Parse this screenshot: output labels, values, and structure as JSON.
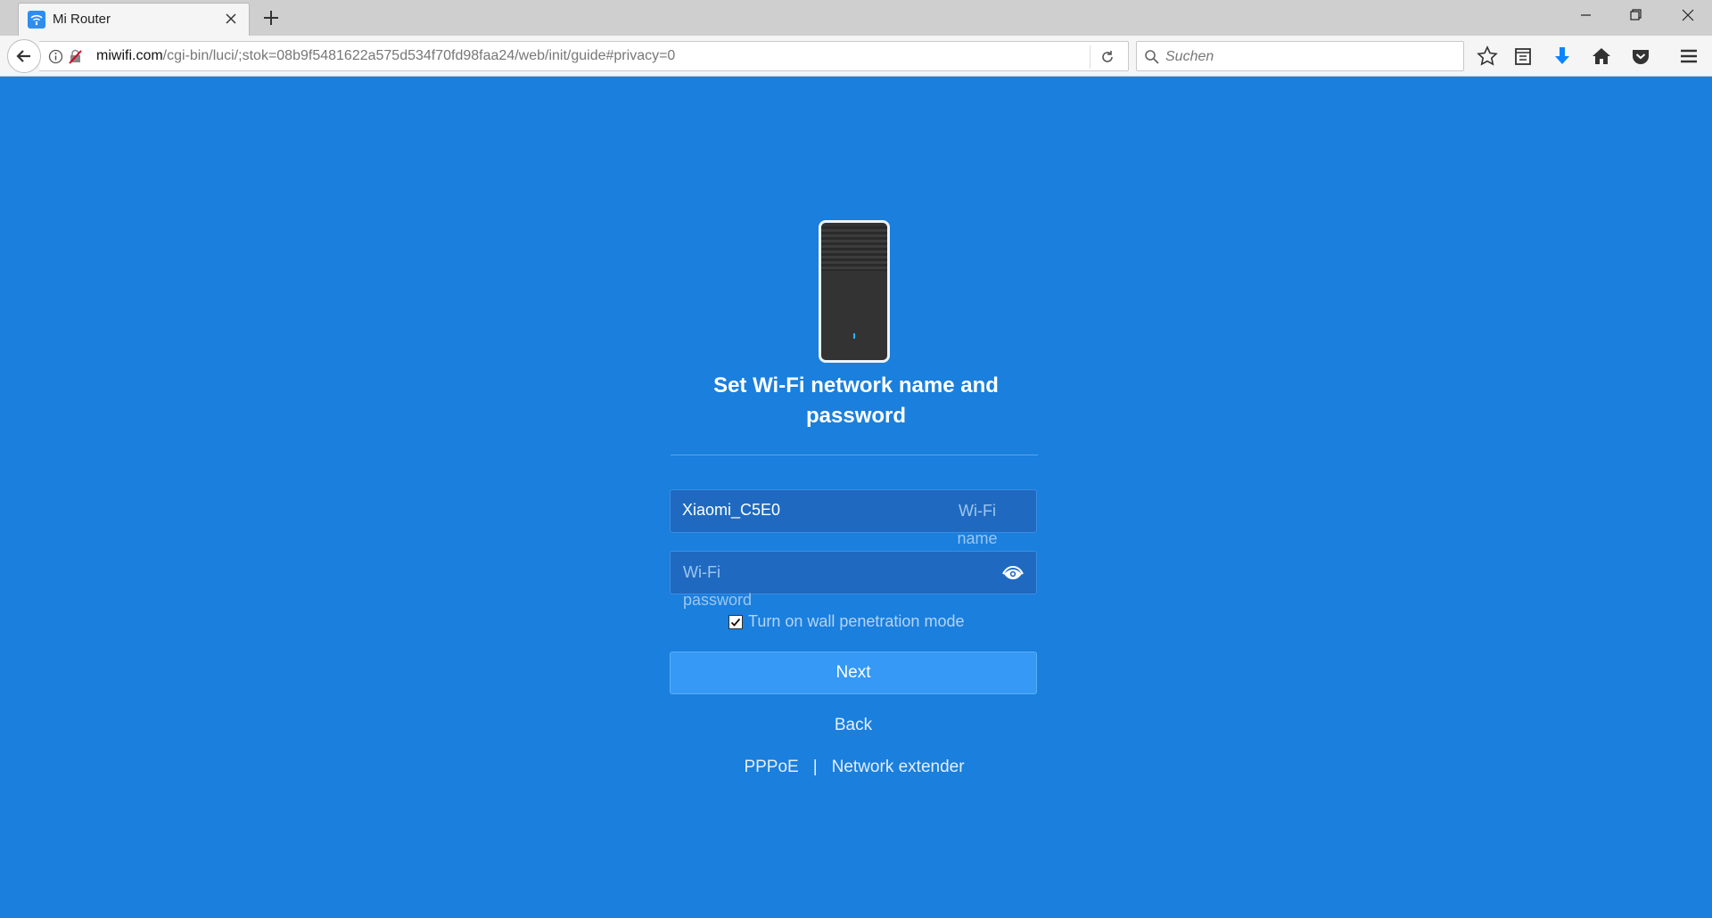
{
  "browser": {
    "tab_title": "Mi Router",
    "url_host": "miwifi.com",
    "url_path": "/cgi-bin/luci/;stok=08b9f5481622a575d534f70fd98faa24/web/init/guide#privacy=0",
    "search_placeholder": "Suchen",
    "toolbar_icons": [
      "bookmark-star-icon",
      "reading-list-icon",
      "download-icon",
      "home-icon",
      "pocket-icon",
      "menu-icon"
    ]
  },
  "page": {
    "heading": "Set Wi-Fi network name and password",
    "ssid": {
      "value": "Xiaomi_C5E0",
      "label": "Wi-Fi name"
    },
    "password": {
      "placeholder": "Wi-Fi password"
    },
    "wall_mode": {
      "label": "Turn on wall penetration mode",
      "checked": true
    },
    "next_label": "Next",
    "back_label": "Back",
    "links": {
      "pppoe": "PPPoE",
      "separator": "|",
      "extender": "Network extender"
    },
    "colors": {
      "background": "#1a7fdd",
      "button": "#3599f5"
    }
  }
}
